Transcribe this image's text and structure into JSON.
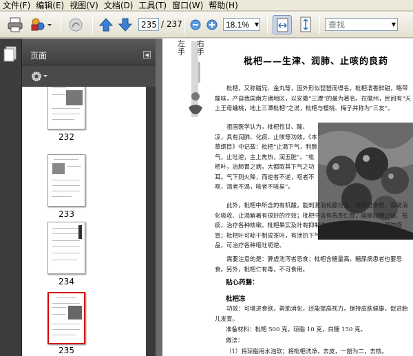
{
  "menu": [
    "文件(F)",
    "编辑(E)",
    "视图(V)",
    "文档(D)",
    "工具(T)",
    "窗口(W)",
    "帮助(H)"
  ],
  "toolbar": {
    "current_page": "235",
    "total_pages": "/ 237",
    "zoom": "18.1%",
    "search_placeholder": "查找"
  },
  "panel": {
    "title": "页面",
    "thumbnails": [
      {
        "label": "232",
        "selected": false
      },
      {
        "label": "233",
        "selected": false
      },
      {
        "label": "234",
        "selected": false
      },
      {
        "label": "235",
        "selected": true
      }
    ]
  },
  "document": {
    "deco_left": "左手",
    "deco_right": "右手",
    "title": "枇杷——生津、润肺、止咳的良药",
    "p1": "枇杷，又称腊兄、金丸等，因外形似琵琶而得名。枇杷清香鲜甜，略带酸味，产自我国南方诸地区，以安徽“三潭”的最为著名。在徽州，民间有“天上王母蟠桃，地上三潭枇杷”之说，枇杷与樱桃、梅子并称为“三友”。",
    "p2": "祖国医学认为，枇杷性甘、酸、凉，具有润肺、化痰、止咳等功效。《本草纲目》中记载：枇杷“止渴下气，利肺气，止吐逆，主上焦热，润五脏”。“枇杷叶，治肺胃之病，大都取其下气之功耳。气下则火降，而逆者不逆，呕者不呕，渴者不渴，咳者不咳矣”。",
    "p3": "此外，枇杷中所含的有机酸，能刺激消化腺分泌，对增进食欲、帮助消化吸收、止渴解暑有很好的疗效；枇杷中含有苦杏仁苷，能够润肺止咳、祛痰，治疗各种咳嗽。枇杷果实及叶有抑制流感病毒作用，常吃可以预防感冒；枇杷叶可晾干制成茶叶，有泄热下气、和胃降逆的功效，为止呕的良品，可治疗各种呕吐呃逆。",
    "p4": "需要注意的是：脾虚泄泻者忌食；枇杷含糖量高，糖尿病患者也要忌食。另外，枇杷仁有毒，不可食用。",
    "tips_heading": "贴心药膳：",
    "recipe_title": "枇杷冻",
    "efficacy": "功效：可增进食欲，帮助消化，还能提高视力，保持皮肤健康，促进胎儿发育。",
    "ingredients": "准备材料：枇杷 500 克，琼脂 10 克，白糖 150 克。",
    "method_label": "做法：",
    "step1": "（1）将琼脂用水泡软；将枇杷洗净，去皮，一剖为二，去核。"
  }
}
